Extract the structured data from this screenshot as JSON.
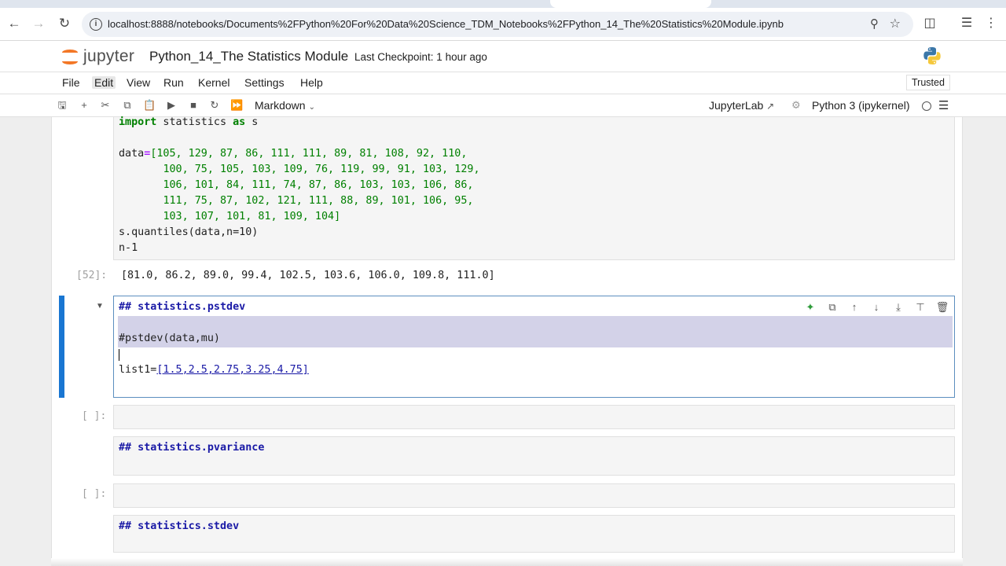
{
  "browser": {
    "url": "localhost:8888/notebooks/Documents%2FPython%20For%20Data%20Science_TDM_Notebooks%2FPython_14_The%20Statistics%20Module.ipynb"
  },
  "header": {
    "logo_text": "jupyter",
    "notebook_title": "Python_14_The Statistics Module",
    "checkpoint": "Last Checkpoint: 1 hour ago"
  },
  "menu": {
    "items": [
      "File",
      "Edit",
      "View",
      "Run",
      "Kernel",
      "Settings",
      "Help"
    ],
    "active": "Edit",
    "trusted": "Trusted"
  },
  "toolbar": {
    "cell_type": "Markdown",
    "jupyterlab_link": "JupyterLab",
    "kernel_name": "Python 3 (ipykernel)"
  },
  "cells": {
    "code1": {
      "line1_kw1": "import",
      "line1_mid": " statistics ",
      "line1_kw2": "as",
      "line1_end": " s",
      "data_name": "data",
      "data_lines": [
        "[105, 129, 87, 86, 111, 111, 89, 81, 108, 92, 110,",
        "100, 75, 105, 103, 109, 76, 119, 99, 91, 103, 129,",
        "106, 101, 84, 111, 74, 87, 86, 103, 103, 106, 86,",
        "111, 75, 87, 102, 121, 111, 88, 89, 101, 106, 95,",
        "103, 107, 101, 81, 109, 104]"
      ],
      "quantiles_call": "s.quantiles(data,n=10)",
      "last_line": "n-1"
    },
    "output1": {
      "prompt": "[52]:",
      "text": "[81.0, 86.2, 89.0, 99.4, 102.5, 103.6, 106.0, 109.8, 111.0]"
    },
    "active_md": {
      "heading": "## statistics.pstdev",
      "comment": "#pstdev(data,mu)",
      "list_name": "list1=",
      "list_value": "[1.5,2.5,2.75,3.25,4.75]"
    },
    "empty_prompt_1": "[ ]:",
    "md_pvariance": "## statistics.pvariance",
    "empty_prompt_2": "[ ]:",
    "md_stdev": "## statistics.stdev"
  },
  "colors": {
    "accent": "#1976d2",
    "jupyter_orange": "#f37726",
    "keyword_green": "#008000",
    "markdown_heading": "#1a1aa6"
  }
}
